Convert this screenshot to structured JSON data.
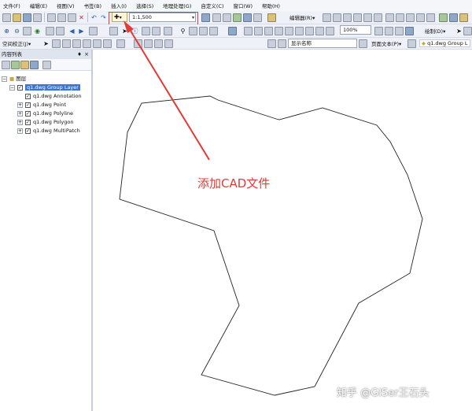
{
  "menu": [
    "文件(F)",
    "编辑(E)",
    "视图(V)",
    "书签(B)",
    "插入(I)",
    "选择(S)",
    "地理处理(G)",
    "自定义(C)",
    "窗口(W)",
    "帮助(H)"
  ],
  "toolbar1": {
    "scale_value": "1:1,500",
    "editor_label": "编辑器(R)▾"
  },
  "toolbar2": {
    "zoom_value": "100%",
    "draw_label": "绘制(D)▾"
  },
  "toolbar3": {
    "georef_label": "空间校正(J)▾",
    "display_name_label": "显示名称",
    "page_text_label": "页面文本(P)▾",
    "layer_tab_label": "q1.dwg Group L"
  },
  "toc": {
    "title": "内容列表",
    "pin": "♦",
    "close": "×",
    "root_label": "图层",
    "group_layer": "q1.dwg Group Layer",
    "layers": [
      "q1.dwg Annotation",
      "q1.dwg Point",
      "q1.dwg Polyline",
      "q1.dwg Polygon",
      "q1.dwg MultiPatch"
    ]
  },
  "annotation": {
    "callout_text": "添加CAD文件"
  },
  "watermark": "知乎 @GISer王石头",
  "colors": {
    "accent_red": "#e53935",
    "selection_blue": "#3875d7"
  }
}
